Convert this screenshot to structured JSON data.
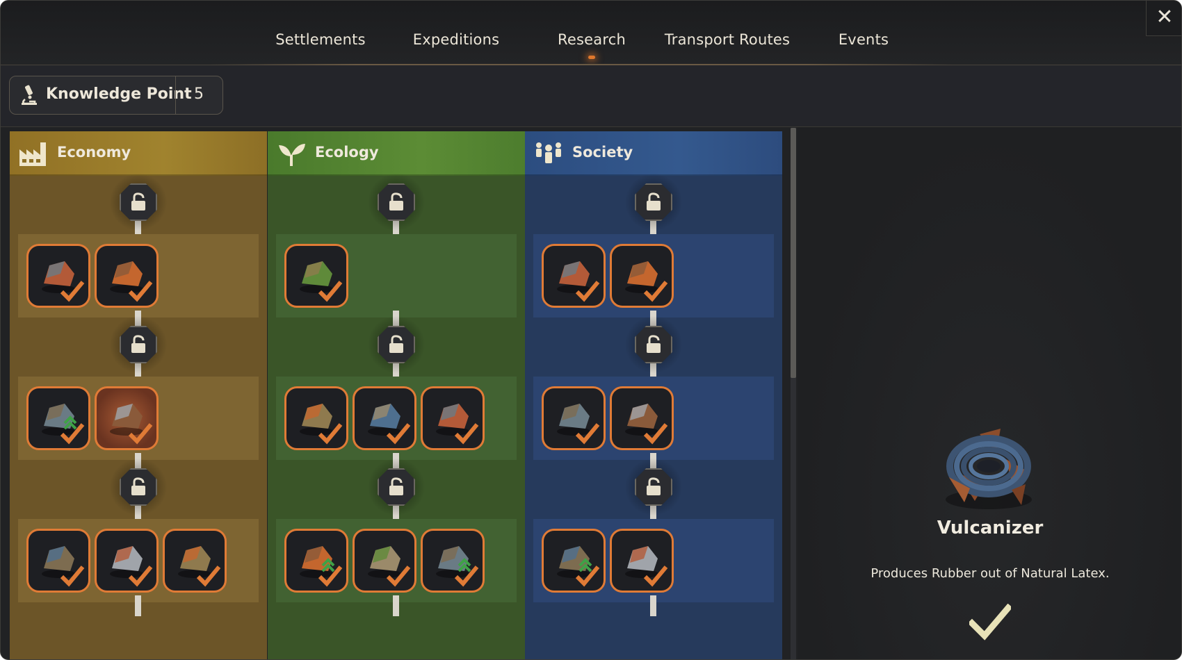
{
  "nav": {
    "tabs": [
      {
        "label": "Settlements"
      },
      {
        "label": "Expeditions"
      },
      {
        "label": "Research"
      },
      {
        "label": "Transport Routes"
      },
      {
        "label": "Events"
      }
    ],
    "active_tab": "Research",
    "close_icon": "close-icon"
  },
  "knowledge": {
    "label": "Knowledge Point",
    "value": "5",
    "icon": "microscope-icon"
  },
  "colors": {
    "accent_orange": "#e07b36",
    "economy": "#917125",
    "ecology": "#4a7a2c",
    "society": "#2c4d80"
  },
  "columns": [
    {
      "title": "Economy",
      "icon": "factory-icon",
      "tiers": [
        [
          "copper-ore-icon",
          "copper-ingot-icon"
        ],
        [
          "crates-upgrade-icon",
          "vulcanizer-icon"
        ],
        [
          "silver-ore-icon",
          "steel-bar-icon",
          "gold-ore-icon"
        ]
      ]
    },
    {
      "title": "Ecology",
      "icon": "sprout-icon",
      "tiers": [
        [
          "mortar-pestle-icon"
        ],
        [
          "furnace-icon",
          "pitchfork-scythe-icon",
          "crate-apples-icon"
        ],
        [
          "bridge-upgrade-icon",
          "pump-icon",
          "trees-upgrade-icon"
        ]
      ]
    },
    {
      "title": "Society",
      "icon": "people-icon",
      "tiers": [
        [
          "cabin-icon",
          "workshop-icon"
        ],
        [
          "syringe-icon",
          "bandage-knife-icon"
        ],
        [
          "scissors-upgrade-icon",
          "urn-icon"
        ]
      ]
    }
  ],
  "detail": {
    "title": "Vulcanizer",
    "description": "Produces Rubber out of Natural Latex.",
    "icon": "vulcanizer-icon",
    "status": "researched"
  }
}
